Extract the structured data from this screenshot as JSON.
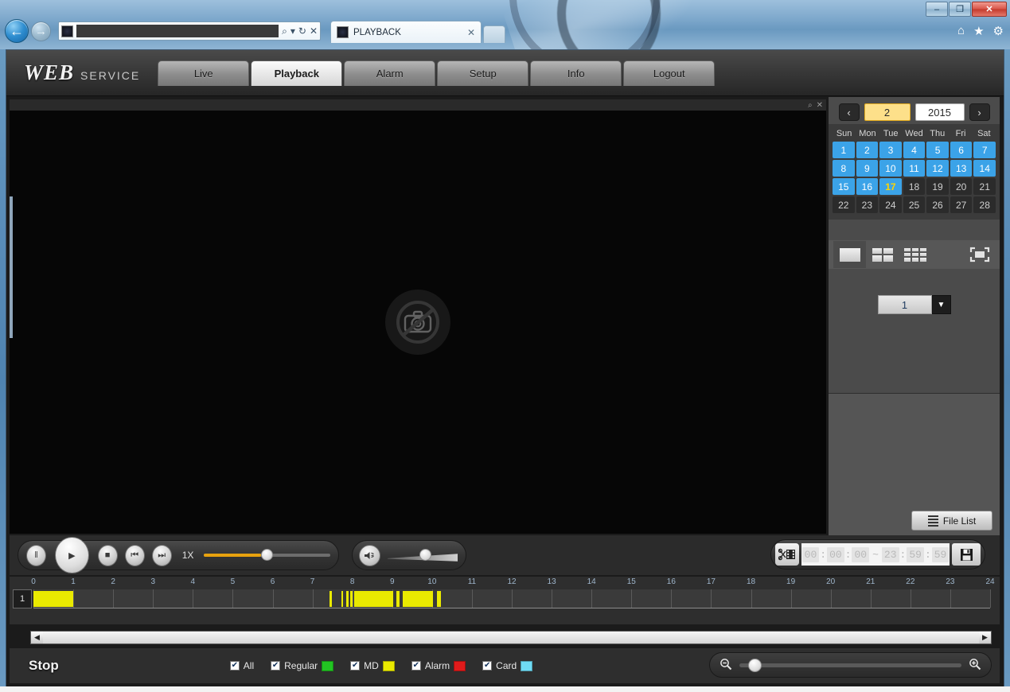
{
  "browser": {
    "window_buttons": {
      "minimize": "–",
      "maximize": "❐",
      "close": "✕"
    },
    "back_icon": "←",
    "forward_icon": "→",
    "address_value": "",
    "address_placeholder": "",
    "search_icon": "⌕",
    "search_dropdown_icon": "▾",
    "refresh_icon": "↻",
    "stop_icon": "✕",
    "tab_title": "PLAYBACK",
    "tab_close": "✕",
    "tools": {
      "home": "⌂",
      "favorites": "★",
      "settings": "⚙"
    }
  },
  "app": {
    "logo_main": "WEB",
    "logo_sub": "SERVICE",
    "nav": [
      {
        "label": "Live",
        "active": false
      },
      {
        "label": "Playback",
        "active": true
      },
      {
        "label": "Alarm",
        "active": false
      },
      {
        "label": "Setup",
        "active": false
      },
      {
        "label": "Info",
        "active": false
      },
      {
        "label": "Logout",
        "active": false
      }
    ]
  },
  "video": {
    "zoom_icon": "⌕",
    "close_icon": "✕",
    "placeholder": "no-video-camera"
  },
  "calendar": {
    "prev_label": "‹",
    "next_label": "›",
    "month": "2",
    "year": "2015",
    "weekdays": [
      "Sun",
      "Mon",
      "Tue",
      "Wed",
      "Thu",
      "Fri",
      "Sat"
    ],
    "days": [
      {
        "n": "1",
        "has_record": true,
        "selected": false
      },
      {
        "n": "2",
        "has_record": true,
        "selected": false
      },
      {
        "n": "3",
        "has_record": true,
        "selected": false
      },
      {
        "n": "4",
        "has_record": true,
        "selected": false
      },
      {
        "n": "5",
        "has_record": true,
        "selected": false
      },
      {
        "n": "6",
        "has_record": true,
        "selected": false
      },
      {
        "n": "7",
        "has_record": true,
        "selected": false
      },
      {
        "n": "8",
        "has_record": true,
        "selected": false
      },
      {
        "n": "9",
        "has_record": true,
        "selected": false
      },
      {
        "n": "10",
        "has_record": true,
        "selected": false
      },
      {
        "n": "11",
        "has_record": true,
        "selected": false
      },
      {
        "n": "12",
        "has_record": true,
        "selected": false
      },
      {
        "n": "13",
        "has_record": true,
        "selected": false
      },
      {
        "n": "14",
        "has_record": true,
        "selected": false
      },
      {
        "n": "15",
        "has_record": true,
        "selected": false
      },
      {
        "n": "16",
        "has_record": true,
        "selected": false
      },
      {
        "n": "17",
        "has_record": true,
        "selected": true
      },
      {
        "n": "18",
        "has_record": false,
        "selected": false
      },
      {
        "n": "19",
        "has_record": false,
        "selected": false
      },
      {
        "n": "20",
        "has_record": false,
        "selected": false
      },
      {
        "n": "21",
        "has_record": false,
        "selected": false
      },
      {
        "n": "22",
        "has_record": false,
        "selected": false
      },
      {
        "n": "23",
        "has_record": false,
        "selected": false
      },
      {
        "n": "24",
        "has_record": false,
        "selected": false
      },
      {
        "n": "25",
        "has_record": false,
        "selected": false
      },
      {
        "n": "26",
        "has_record": false,
        "selected": false
      },
      {
        "n": "27",
        "has_record": false,
        "selected": false
      },
      {
        "n": "28",
        "has_record": false,
        "selected": false
      }
    ]
  },
  "layout_buttons": {
    "one": "1-window",
    "four": "4-window",
    "nine": "9-window",
    "fullscreen": "fullscreen"
  },
  "channel_select": {
    "value": "1",
    "arrow": "▼"
  },
  "file_list_button": {
    "label": "File List"
  },
  "controls": {
    "pause_icon": "‖",
    "play_icon": "▶",
    "stop_icon": "■",
    "prev_frame_icon": "⏮",
    "next_frame_icon": "⏭",
    "speed_label": "1X",
    "speed_value": 45,
    "volume_value": 50,
    "volume_icon": "speaker"
  },
  "clip": {
    "scissors_icon": "video-clip",
    "start": [
      "00",
      "00",
      "00"
    ],
    "end": [
      "23",
      "59",
      "59"
    ],
    "separator": "~",
    "colon": ":",
    "save_icon": "floppy-disk"
  },
  "timeline": {
    "channel_label": "1",
    "hours": [
      "0",
      "1",
      "2",
      "3",
      "4",
      "5",
      "6",
      "7",
      "8",
      "9",
      "10",
      "11",
      "12",
      "13",
      "14",
      "15",
      "16",
      "17",
      "18",
      "19",
      "20",
      "21",
      "22",
      "23",
      "24"
    ],
    "segments": [
      {
        "start": 0.0,
        "end": 1.0
      },
      {
        "start": 7.42,
        "end": 7.48
      },
      {
        "start": 7.72,
        "end": 7.76
      },
      {
        "start": 7.84,
        "end": 7.9
      },
      {
        "start": 7.95,
        "end": 8.0
      },
      {
        "start": 8.05,
        "end": 9.02
      },
      {
        "start": 9.1,
        "end": 9.18
      },
      {
        "start": 9.27,
        "end": 10.02
      },
      {
        "start": 10.12,
        "end": 10.22
      }
    ],
    "color": "#eaea00"
  },
  "scrollbar": {
    "left_arrow": "◀",
    "right_arrow": "▶"
  },
  "status": {
    "text": "Stop"
  },
  "legend": {
    "check": "✔",
    "items": [
      {
        "label": "All",
        "checked": true,
        "color": null
      },
      {
        "label": "Regular",
        "checked": true,
        "color": "#22c422"
      },
      {
        "label": "MD",
        "checked": true,
        "color": "#eaea00"
      },
      {
        "label": "Alarm",
        "checked": true,
        "color": "#e01b1b"
      },
      {
        "label": "Card",
        "checked": true,
        "color": "#6fdcf5"
      }
    ]
  },
  "zoom_slider": {
    "out_icon": "zoom-out",
    "in_icon": "zoom-in",
    "value": 4
  }
}
